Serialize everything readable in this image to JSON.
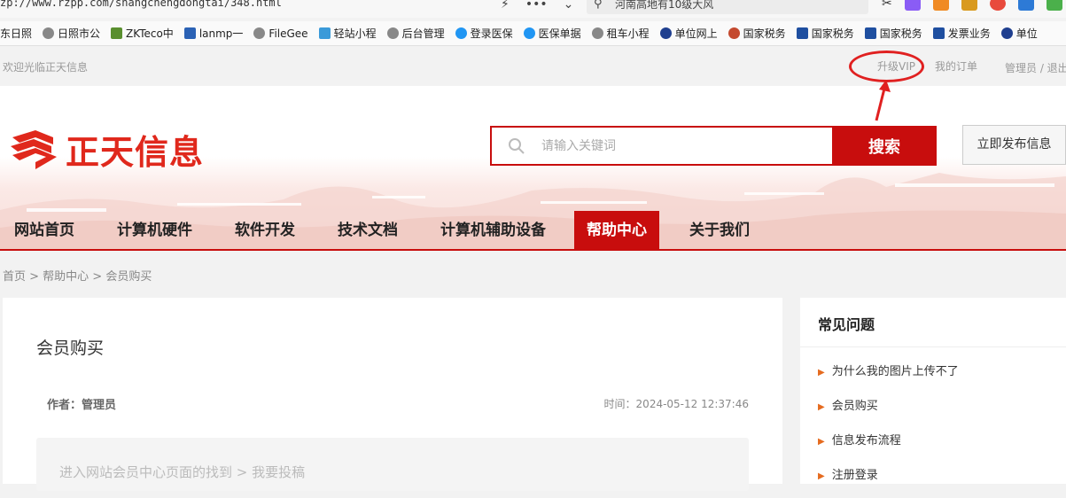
{
  "browser": {
    "url": "zp://www.rzpp.com/shangchengdongtai/348.html",
    "search_text": "河南高地有10级大风",
    "bookmarks": [
      {
        "label": "东日照"
      },
      {
        "label": "日照市公"
      },
      {
        "label": "ZKTeco中"
      },
      {
        "label": "lanmp一"
      },
      {
        "label": "FileGee"
      },
      {
        "label": "轻站小程"
      },
      {
        "label": "后台管理"
      },
      {
        "label": "登录医保"
      },
      {
        "label": "医保单据"
      },
      {
        "label": "租车小程"
      },
      {
        "label": "单位网上"
      },
      {
        "label": "国家税务"
      },
      {
        "label": "国家税务"
      },
      {
        "label": "国家税务"
      },
      {
        "label": "发票业务"
      },
      {
        "label": "单位"
      }
    ]
  },
  "topbar": {
    "welcome": "欢迎光临正天信息",
    "upgrade_vip": "升级VIP",
    "my_orders": "我的订单",
    "admin": "管理员 / 退出"
  },
  "header": {
    "logo_text": "正天信息",
    "search_placeholder": "请输入关键词",
    "search_button": "搜索",
    "publish_button": "立即发布信息"
  },
  "nav": {
    "items": [
      {
        "label": "网站首页"
      },
      {
        "label": "计算机硬件"
      },
      {
        "label": "软件开发"
      },
      {
        "label": "技术文档"
      },
      {
        "label": "计算机辅助设备"
      },
      {
        "label": "帮助中心"
      },
      {
        "label": "关于我们"
      }
    ],
    "active_index": 5
  },
  "breadcrumb": "首页 > 帮助中心 > 会员购买",
  "article": {
    "title": "会员购买",
    "author": "作者：管理员",
    "time": "时间：2024-05-12 12:37:46",
    "body_start": "进入网站会员中心页面的找到 > 我要投稿"
  },
  "sidebar": {
    "title": "常见问题",
    "items": [
      {
        "label": "为什么我的图片上传不了"
      },
      {
        "label": "会员购买"
      },
      {
        "label": "信息发布流程"
      },
      {
        "label": "注册登录"
      }
    ]
  },
  "colors": {
    "brand_red": "#c80d0d",
    "logo_red": "#e0281c",
    "annotation_red": "#e02020"
  }
}
